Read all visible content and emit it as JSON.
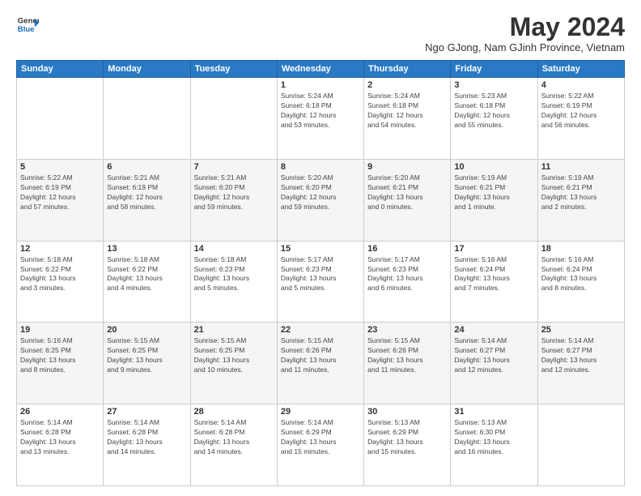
{
  "logo": {
    "line1": "General",
    "line2": "Blue"
  },
  "title": "May 2024",
  "location": "Ngo GJong, Nam GJinh Province, Vietnam",
  "days_header": [
    "Sunday",
    "Monday",
    "Tuesday",
    "Wednesday",
    "Thursday",
    "Friday",
    "Saturday"
  ],
  "weeks": [
    [
      {
        "day": "",
        "info": ""
      },
      {
        "day": "",
        "info": ""
      },
      {
        "day": "",
        "info": ""
      },
      {
        "day": "1",
        "info": "Sunrise: 5:24 AM\nSunset: 6:18 PM\nDaylight: 12 hours\nand 53 minutes."
      },
      {
        "day": "2",
        "info": "Sunrise: 5:24 AM\nSunset: 6:18 PM\nDaylight: 12 hours\nand 54 minutes."
      },
      {
        "day": "3",
        "info": "Sunrise: 5:23 AM\nSunset: 6:18 PM\nDaylight: 12 hours\nand 55 minutes."
      },
      {
        "day": "4",
        "info": "Sunrise: 5:22 AM\nSunset: 6:19 PM\nDaylight: 12 hours\nand 56 minutes."
      }
    ],
    [
      {
        "day": "5",
        "info": "Sunrise: 5:22 AM\nSunset: 6:19 PM\nDaylight: 12 hours\nand 57 minutes."
      },
      {
        "day": "6",
        "info": "Sunrise: 5:21 AM\nSunset: 6:19 PM\nDaylight: 12 hours\nand 58 minutes."
      },
      {
        "day": "7",
        "info": "Sunrise: 5:21 AM\nSunset: 6:20 PM\nDaylight: 12 hours\nand 59 minutes."
      },
      {
        "day": "8",
        "info": "Sunrise: 5:20 AM\nSunset: 6:20 PM\nDaylight: 12 hours\nand 59 minutes."
      },
      {
        "day": "9",
        "info": "Sunrise: 5:20 AM\nSunset: 6:21 PM\nDaylight: 13 hours\nand 0 minutes."
      },
      {
        "day": "10",
        "info": "Sunrise: 5:19 AM\nSunset: 6:21 PM\nDaylight: 13 hours\nand 1 minute."
      },
      {
        "day": "11",
        "info": "Sunrise: 5:19 AM\nSunset: 6:21 PM\nDaylight: 13 hours\nand 2 minutes."
      }
    ],
    [
      {
        "day": "12",
        "info": "Sunrise: 5:18 AM\nSunset: 6:22 PM\nDaylight: 13 hours\nand 3 minutes."
      },
      {
        "day": "13",
        "info": "Sunrise: 5:18 AM\nSunset: 6:22 PM\nDaylight: 13 hours\nand 4 minutes."
      },
      {
        "day": "14",
        "info": "Sunrise: 5:18 AM\nSunset: 6:23 PM\nDaylight: 13 hours\nand 5 minutes."
      },
      {
        "day": "15",
        "info": "Sunrise: 5:17 AM\nSunset: 6:23 PM\nDaylight: 13 hours\nand 5 minutes."
      },
      {
        "day": "16",
        "info": "Sunrise: 5:17 AM\nSunset: 6:23 PM\nDaylight: 13 hours\nand 6 minutes."
      },
      {
        "day": "17",
        "info": "Sunrise: 5:16 AM\nSunset: 6:24 PM\nDaylight: 13 hours\nand 7 minutes."
      },
      {
        "day": "18",
        "info": "Sunrise: 5:16 AM\nSunset: 6:24 PM\nDaylight: 13 hours\nand 8 minutes."
      }
    ],
    [
      {
        "day": "19",
        "info": "Sunrise: 5:16 AM\nSunset: 6:25 PM\nDaylight: 13 hours\nand 8 minutes."
      },
      {
        "day": "20",
        "info": "Sunrise: 5:15 AM\nSunset: 6:25 PM\nDaylight: 13 hours\nand 9 minutes."
      },
      {
        "day": "21",
        "info": "Sunrise: 5:15 AM\nSunset: 6:25 PM\nDaylight: 13 hours\nand 10 minutes."
      },
      {
        "day": "22",
        "info": "Sunrise: 5:15 AM\nSunset: 6:26 PM\nDaylight: 13 hours\nand 11 minutes."
      },
      {
        "day": "23",
        "info": "Sunrise: 5:15 AM\nSunset: 6:26 PM\nDaylight: 13 hours\nand 11 minutes."
      },
      {
        "day": "24",
        "info": "Sunrise: 5:14 AM\nSunset: 6:27 PM\nDaylight: 13 hours\nand 12 minutes."
      },
      {
        "day": "25",
        "info": "Sunrise: 5:14 AM\nSunset: 6:27 PM\nDaylight: 13 hours\nand 12 minutes."
      }
    ],
    [
      {
        "day": "26",
        "info": "Sunrise: 5:14 AM\nSunset: 6:28 PM\nDaylight: 13 hours\nand 13 minutes."
      },
      {
        "day": "27",
        "info": "Sunrise: 5:14 AM\nSunset: 6:28 PM\nDaylight: 13 hours\nand 14 minutes."
      },
      {
        "day": "28",
        "info": "Sunrise: 5:14 AM\nSunset: 6:28 PM\nDaylight: 13 hours\nand 14 minutes."
      },
      {
        "day": "29",
        "info": "Sunrise: 5:14 AM\nSunset: 6:29 PM\nDaylight: 13 hours\nand 15 minutes."
      },
      {
        "day": "30",
        "info": "Sunrise: 5:13 AM\nSunset: 6:29 PM\nDaylight: 13 hours\nand 15 minutes."
      },
      {
        "day": "31",
        "info": "Sunrise: 5:13 AM\nSunset: 6:30 PM\nDaylight: 13 hours\nand 16 minutes."
      },
      {
        "day": "",
        "info": ""
      }
    ]
  ]
}
